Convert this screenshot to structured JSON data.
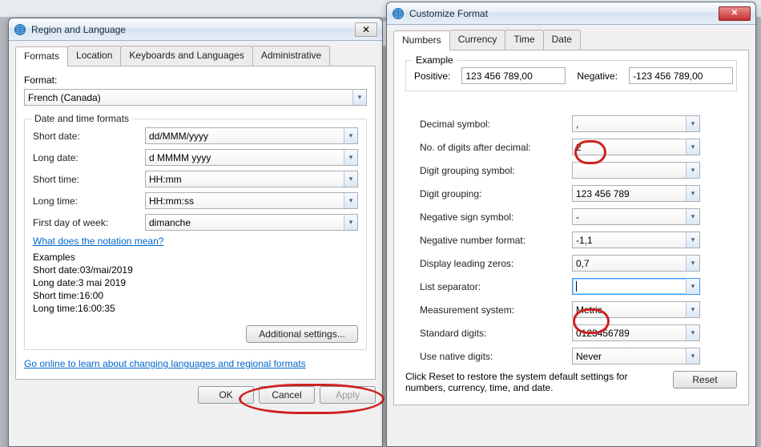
{
  "region_window": {
    "title": "Region and Language",
    "tabs": [
      "Formats",
      "Location",
      "Keyboards and Languages",
      "Administrative"
    ],
    "format_label": "Format:",
    "format_value": "French (Canada)",
    "date_time_group": "Date and time formats",
    "fields": {
      "short_date_label": "Short date:",
      "short_date_value": "dd/MMM/yyyy",
      "long_date_label": "Long date:",
      "long_date_value": "d MMMM yyyy",
      "short_time_label": "Short time:",
      "short_time_value": "HH:mm",
      "long_time_label": "Long time:",
      "long_time_value": "HH:mm:ss",
      "first_dow_label": "First day of week:",
      "first_dow_value": "dimanche"
    },
    "notation_link": "What does the notation mean?",
    "examples_group": "Examples",
    "examples": {
      "short_date_label": "Short date:",
      "short_date_value": "03/mai/2019",
      "long_date_label": "Long date:",
      "long_date_value": "3 mai 2019",
      "short_time_label": "Short time:",
      "short_time_value": "16:00",
      "long_time_label": "Long time:",
      "long_time_value": "16:00:35"
    },
    "additional_settings": "Additional settings...",
    "online_link": "Go online to learn about changing languages and regional formats",
    "buttons": {
      "ok": "OK",
      "cancel": "Cancel",
      "apply": "Apply"
    }
  },
  "customize_window": {
    "title": "Customize Format",
    "tabs": [
      "Numbers",
      "Currency",
      "Time",
      "Date"
    ],
    "example_group": "Example",
    "example": {
      "positive_label": "Positive:",
      "positive_value": "123 456 789,00",
      "negative_label": "Negative:",
      "negative_value": "-123 456 789,00"
    },
    "settings": {
      "decimal_symbol_label": "Decimal symbol:",
      "decimal_symbol_value": ",",
      "digits_after_label": "No. of digits after decimal:",
      "digits_after_value": "2",
      "grouping_symbol_label": "Digit grouping symbol:",
      "grouping_symbol_value": "",
      "digit_grouping_label": "Digit grouping:",
      "digit_grouping_value": "123 456 789",
      "negative_sign_label": "Negative sign symbol:",
      "negative_sign_value": "-",
      "negative_format_label": "Negative number format:",
      "negative_format_value": "-1,1",
      "leading_zeros_label": "Display leading zeros:",
      "leading_zeros_value": "0,7",
      "list_separator_label": "List separator:",
      "list_separator_value": "",
      "measurement_label": "Measurement system:",
      "measurement_value": "Metric",
      "standard_digits_label": "Standard digits:",
      "standard_digits_value": "0123456789",
      "native_digits_label": "Use native digits:",
      "native_digits_value": "Never"
    },
    "reset_hint": "Click Reset to restore the system default settings for numbers, currency, time, and date.",
    "reset_button": "Reset"
  }
}
